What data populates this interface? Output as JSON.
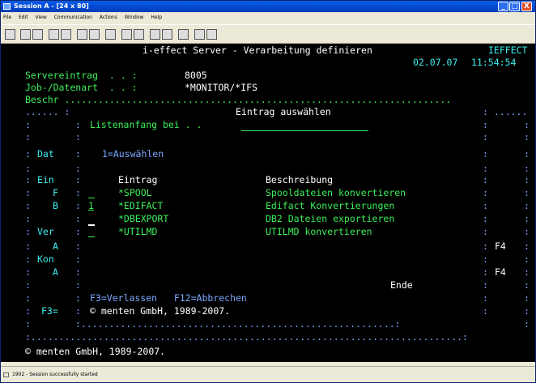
{
  "window": {
    "title": "Session A - [24 x 80]",
    "min": "_",
    "max": "□",
    "close": "X"
  },
  "menu": [
    "File",
    "Edit",
    "View",
    "Communication",
    "Actions",
    "Window",
    "Help"
  ],
  "terminal": {
    "header_title": "i-effect Server - Verarbeitung definieren",
    "header_id": "IEFFECT",
    "date": "02.07.07",
    "time": "11:54:54",
    "server_label": "Servereintrag  . . :",
    "server_value": "8005",
    "job_label": "Job-/Datenart  . . :",
    "job_value": "*MONITOR/*IFS",
    "beschr_line": "Beschr .....................................................................",
    "popup_top": "...... :",
    "popup_title": "Eintrag auswählen",
    "popup_top_right": ": ......",
    "listenanfang": "Listenanfang bei . .",
    "dat": "Dat",
    "auswahl": "1=Auswählen",
    "ein": "Ein",
    "col_eintrag": "Eintrag",
    "col_beschreibung": "Beschreibung",
    "f": "F",
    "b": "B",
    "ver": "Ver",
    "a": "A",
    "kon": "Kon",
    "f4": "F4",
    "rows": [
      {
        "opt": "",
        "entry": "*SPOOL",
        "desc": "Spooldateien konvertieren"
      },
      {
        "opt": "1",
        "entry": "*EDIFACT",
        "desc": "Edifact Konvertierungen"
      },
      {
        "opt": "",
        "entry": "*DBEXPORT",
        "desc": "DB2 Dateien exportieren"
      },
      {
        "opt": "",
        "entry": "*UTILMD",
        "desc": "UTILMD konvertieren"
      }
    ],
    "ende": "Ende",
    "fkeys": "F3=Verlassen   F12=Abbrechen",
    "f3eq": "F3=",
    "copyright_inner": "© menten GmbH, 1989-2007.",
    "copyright_bottom": "© menten GmbH, 1989-2007."
  },
  "status": {
    "text": "1902 - Session successfully started"
  }
}
